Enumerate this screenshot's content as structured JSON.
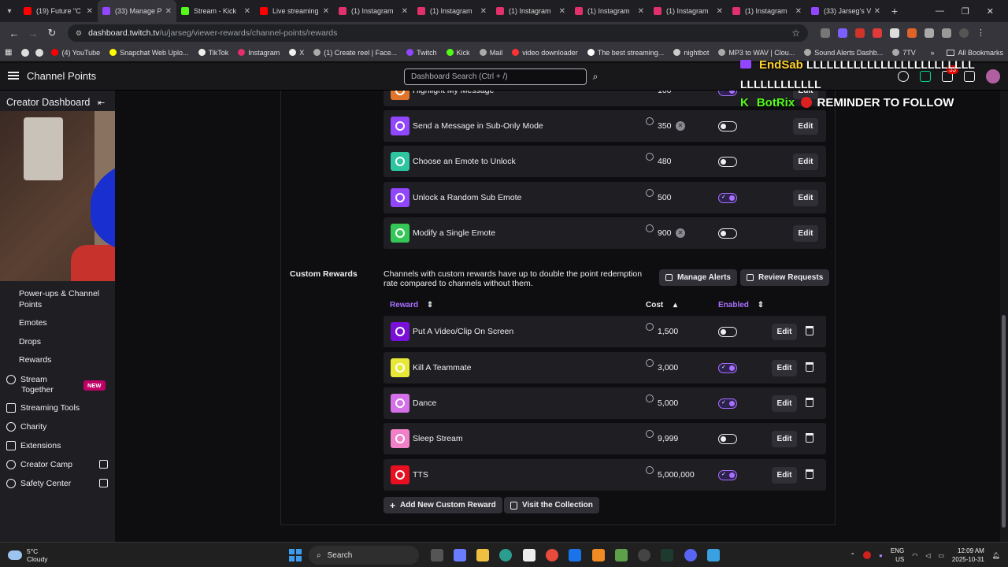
{
  "browser": {
    "tabs": [
      {
        "title": "(19) Future \"C",
        "color": "#ff0000"
      },
      {
        "title": "(33) Manage P",
        "color": "#9146ff",
        "active": true
      },
      {
        "title": "Stream - Kick",
        "color": "#53fc18"
      },
      {
        "title": "Live streaming",
        "color": "#ff0000"
      },
      {
        "title": "(1) Instagram",
        "color": "#e1306c"
      },
      {
        "title": "(1) Instagram",
        "color": "#e1306c"
      },
      {
        "title": "(1) Instagram",
        "color": "#e1306c"
      },
      {
        "title": "(1) Instagram",
        "color": "#e1306c"
      },
      {
        "title": "(1) Instagram",
        "color": "#e1306c"
      },
      {
        "title": "(1) Instagram",
        "color": "#e1306c"
      },
      {
        "title": "(33) Jarseg's V",
        "color": "#9146ff"
      }
    ],
    "url_host": "dashboard.twitch.tv",
    "url_path": "/u/jarseg/viewer-rewards/channel-points/rewards",
    "bookmarks": [
      {
        "label": "(4) YouTube",
        "color": "#ff0000"
      },
      {
        "label": "Snapchat Web Uplo...",
        "color": "#fffc00"
      },
      {
        "label": "TikTok",
        "color": "#eeeeee"
      },
      {
        "label": "Instagram",
        "color": "#e1306c"
      },
      {
        "label": "X",
        "color": "#eeeeee"
      },
      {
        "label": "(1) Create reel | Face...",
        "color": "#aaaaaa"
      },
      {
        "label": "Twitch",
        "color": "#9146ff"
      },
      {
        "label": "Kick",
        "color": "#53fc18"
      },
      {
        "label": "Mail",
        "color": "#aaaaaa"
      },
      {
        "label": "video downloader",
        "color": "#ff3333"
      },
      {
        "label": "The best streaming...",
        "color": "#ffffff"
      },
      {
        "label": "nightbot",
        "color": "#cccccc"
      },
      {
        "label": "MP3 to WAV | Clou...",
        "color": "#aaaaaa"
      },
      {
        "label": "Sound Alerts Dashb...",
        "color": "#aaaaaa"
      },
      {
        "label": "7TV",
        "color": "#aaaaaa"
      }
    ],
    "all_bookmarks": "All Bookmarks"
  },
  "topnav": {
    "title": "Channel Points",
    "search_placeholder": "Dashboard Search (Ctrl + /)",
    "notif_count": "33"
  },
  "sidebar": {
    "header": "Creator Dashboard",
    "items": [
      {
        "label": "Power-ups & Channel"
      },
      {
        "label": "Points"
      },
      {
        "label": "Emotes"
      },
      {
        "label": "Drops"
      },
      {
        "label": "Rewards"
      },
      {
        "label": "Stream"
      },
      {
        "label": "Together"
      },
      {
        "label": "Streaming Tools"
      },
      {
        "label": "Charity"
      },
      {
        "label": "Extensions"
      },
      {
        "label": "Creator Camp"
      },
      {
        "label": "Safety Center"
      }
    ],
    "new_badge": "NEW"
  },
  "standard_rewards": [
    {
      "name": "Highlight My Message",
      "cost": "100",
      "enabled": true,
      "color": "#e0742a"
    },
    {
      "name": "Send a Message in Sub-Only Mode",
      "cost": "350",
      "enabled": false,
      "color": "#9146ff",
      "badge": true
    },
    {
      "name": "Choose an Emote to Unlock",
      "cost": "480",
      "enabled": false,
      "color": "#2ec4a0"
    },
    {
      "name": "Unlock a Random Sub Emote",
      "cost": "500",
      "enabled": true,
      "color": "#9146ff"
    },
    {
      "name": "Modify a Single Emote",
      "cost": "900",
      "enabled": false,
      "color": "#34c758",
      "badge": true
    }
  ],
  "custom": {
    "title": "Custom Rewards",
    "description": "Channels with custom rewards have up to double the point redemption rate compared to channels without them.",
    "manage_alerts": "Manage Alerts",
    "review_requests": "Review Requests",
    "col_reward": "Reward",
    "col_cost": "Cost",
    "col_enabled": "Enabled",
    "edit_label": "Edit",
    "add_label": "Add New Custom Reward",
    "visit_label": "Visit the Collection",
    "rewards": [
      {
        "name": "Put A Video/Clip On Screen",
        "cost": "1,500",
        "enabled": false,
        "color": "#7a10d8"
      },
      {
        "name": "Kill A Teammate",
        "cost": "3,000",
        "enabled": true,
        "color": "#e8e838"
      },
      {
        "name": "Dance",
        "cost": "5,000",
        "enabled": true,
        "color": "#d470e8"
      },
      {
        "name": "Sleep Stream",
        "cost": "9,999",
        "enabled": false,
        "color": "#f080c8"
      },
      {
        "name": "TTS",
        "cost": "5,000,000",
        "enabled": true,
        "color": "#e81020"
      }
    ]
  },
  "chat": {
    "user1": "EndSab",
    "msg1a": "LLLLLLLLLLLLLLLLLLLLLLLLL",
    "msg1b": "LLLLLLLLLLLL",
    "user2": "BotRix",
    "msg2": "REMINDER TO FOLLOW"
  },
  "taskbar": {
    "temp": "5°C",
    "weather": "Cloudy",
    "search": "Search",
    "lang": "ENG",
    "region": "US",
    "time": "12:09 AM",
    "date": "2025-10-31"
  }
}
